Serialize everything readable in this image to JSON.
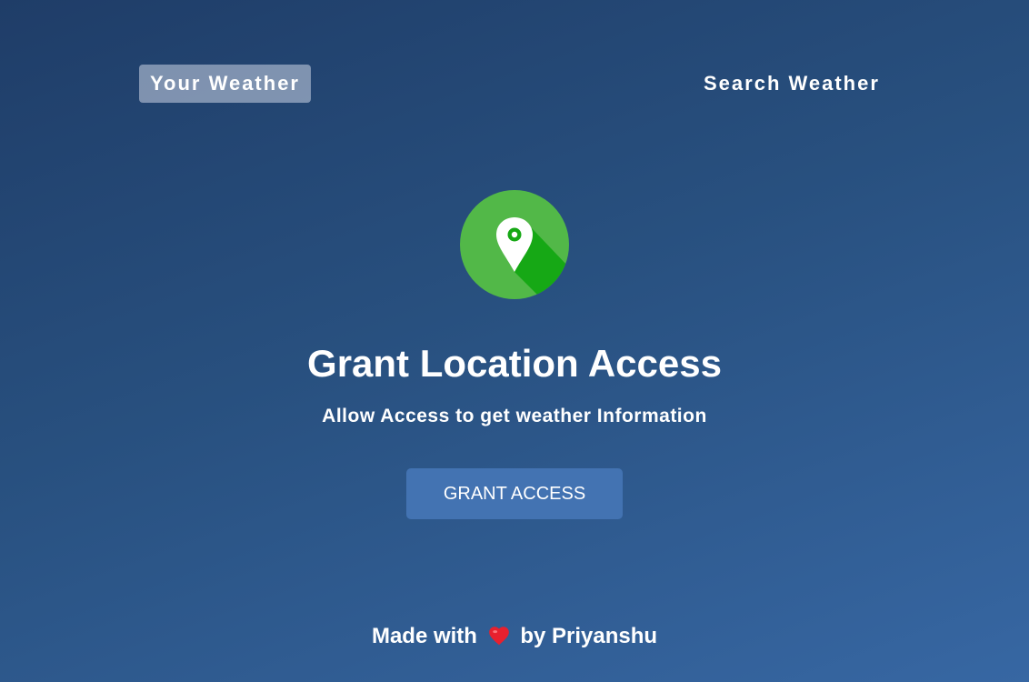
{
  "tabs": {
    "your_weather": "Your Weather",
    "search_weather": "Search Weather"
  },
  "grant": {
    "icon": "location-pin-icon",
    "title": "Grant Location Access",
    "subtitle": "Allow Access to get weather Information",
    "button_label": "GRANT ACCESS"
  },
  "footer": {
    "prefix": "Made with",
    "icon": "heart-icon",
    "suffix": "by Priyanshu"
  },
  "colors": {
    "background_start": "#1f3d68",
    "background_end": "#3767a3",
    "button": "#4373b2",
    "active_tab": "rgba(219,226,239,0.5)",
    "icon_green": "#52b848",
    "icon_shadow_green": "#16a815",
    "heart_red": "#e8202e"
  }
}
